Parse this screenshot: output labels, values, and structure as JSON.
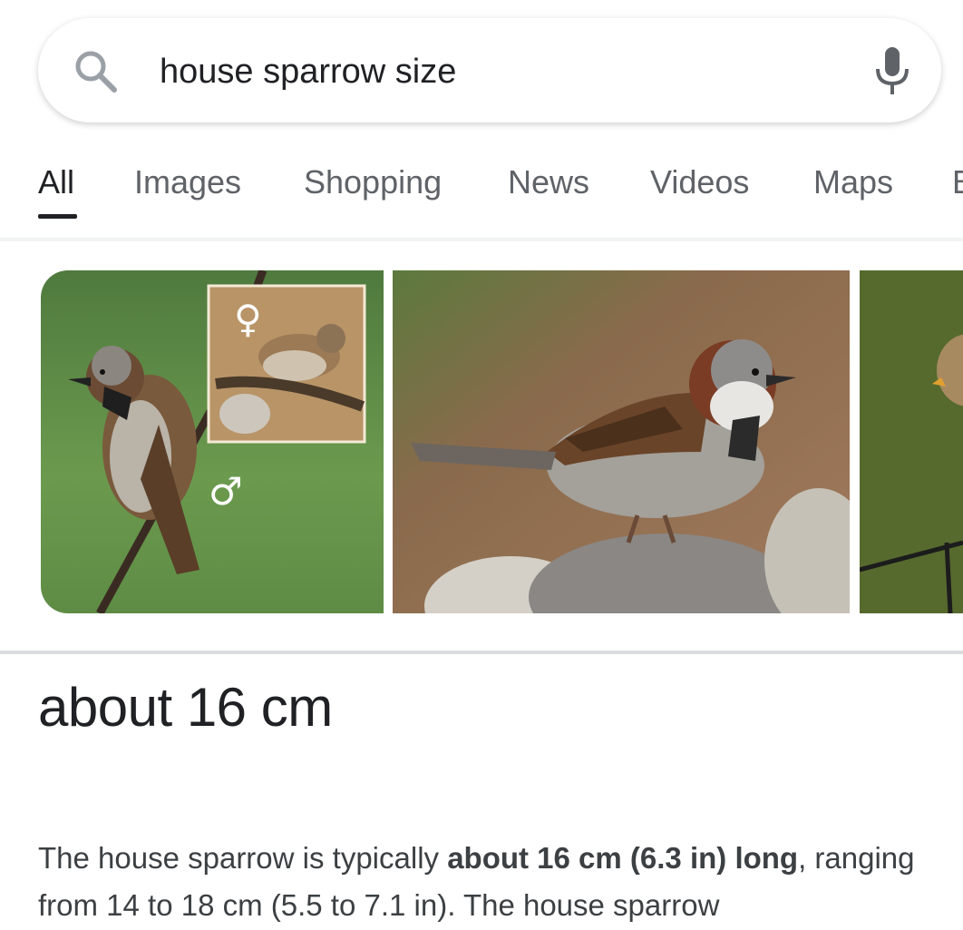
{
  "search": {
    "query": "house sparrow size"
  },
  "tabs": [
    {
      "label": "All",
      "active": true
    },
    {
      "label": "Images"
    },
    {
      "label": "Shopping"
    },
    {
      "label": "News"
    },
    {
      "label": "Videos"
    },
    {
      "label": "Maps"
    },
    {
      "label": "B"
    }
  ],
  "images": {
    "female_symbol": "♀",
    "male_symbol": "♂"
  },
  "answer": {
    "headline": "about 16 cm",
    "description_prefix": "The house sparrow is typically ",
    "description_bold": "about 16 cm (6.3 in) long",
    "description_suffix": ", ranging from 14 to 18 cm (5.5 to 7.1 in). The house sparrow"
  },
  "colors": {
    "text_primary": "#202124",
    "text_secondary": "#5f6368",
    "divider": "#dadce0"
  }
}
